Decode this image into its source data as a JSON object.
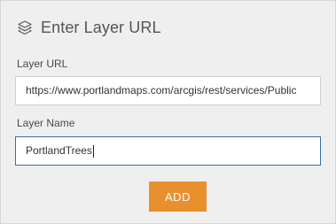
{
  "header": {
    "title": "Enter Layer URL",
    "icon": "layers-icon"
  },
  "form": {
    "url_label": "Layer URL",
    "url_value": "https://www.portlandmaps.com/arcgis/rest/services/Public",
    "name_label": "Layer Name",
    "name_value": "PortlandTrees"
  },
  "actions": {
    "add_label": "ADD"
  },
  "colors": {
    "panel_background": "#efefef",
    "add_button": "#e8902e",
    "focused_border": "#3b6fa0"
  }
}
